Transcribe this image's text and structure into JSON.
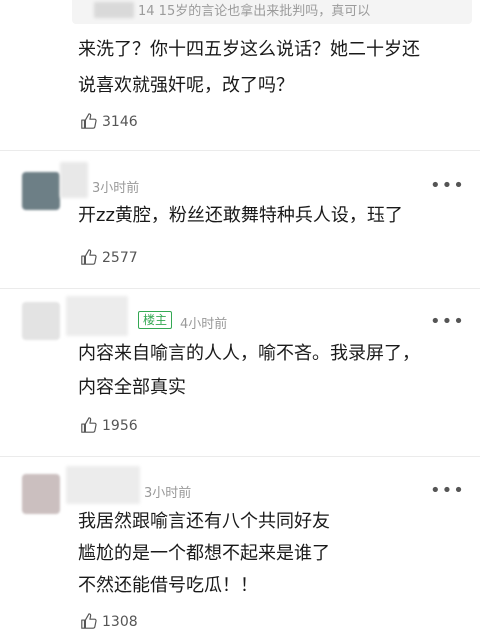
{
  "quote": {
    "text": "14 15岁的言论也拿出来批判吗，真可以"
  },
  "comments": [
    {
      "time": "",
      "lines": [
        "来洗了？你十四五岁这么说话？她二十岁还",
        "说喜欢就强奸呢，改了吗？"
      ],
      "likes": "3146"
    },
    {
      "time": "3小时前",
      "lines": [
        "开zz黄腔，粉丝还敢舞特种兵人设，珏了"
      ],
      "likes": "2577"
    },
    {
      "badge": "楼主",
      "time": "4小时前",
      "lines": [
        "内容来自喻言的人人，喻不吝。我录屏了，",
        "内容全部真实"
      ],
      "likes": "1956"
    },
    {
      "time": "3小时前",
      "lines": [
        "我居然跟喻言还有八个共同好友",
        "尴尬的是一个都想不起来是谁了",
        "不然还能借号吃瓜！！"
      ],
      "likes": "1308"
    }
  ],
  "more_label": "•••",
  "icons": {
    "like": "thumbs-up-icon",
    "more": "more-dots-icon"
  }
}
